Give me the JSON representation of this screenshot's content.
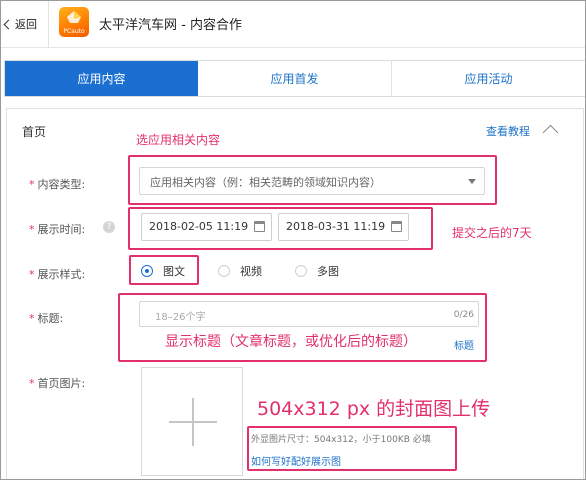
{
  "header": {
    "back_label": "返回",
    "logo_text": "PCauto",
    "title": "太平洋汽车网 - 内容合作"
  },
  "tabs": [
    {
      "label": "应用内容",
      "active": true
    },
    {
      "label": "应用首发",
      "active": false
    },
    {
      "label": "应用活动",
      "active": false
    }
  ],
  "section": {
    "title": "首页",
    "tutorial_link": "查看教程"
  },
  "form": {
    "content_type": {
      "label": "内容类型:",
      "value": "应用相关内容（例：相关范畴的领域知识内容）"
    },
    "display_time": {
      "label": "展示时间:",
      "help": "?",
      "start": "2018-02-05 11:19",
      "end": "2018-03-31 11:19"
    },
    "display_style": {
      "label": "展示样式:",
      "options": [
        "图文",
        "视频",
        "多图"
      ],
      "selected": "图文"
    },
    "title_field": {
      "label": "标题:",
      "placeholder": "18–26个字",
      "counter": "0/26",
      "tip_link_tail": "标题"
    },
    "cover_image": {
      "label": "首页图片:",
      "hint": "外显图片尺寸：504x312，小于100KB 必填",
      "help_link": "如何写好配好展示图"
    }
  },
  "annotations": {
    "select_related": "选应用相关内容",
    "seven_days": "提交之后的7天",
    "title_note": "显示标题（文章标题，或优化后的标题）",
    "cover_note": "504x312 px 的封面图上传"
  },
  "colors": {
    "accent": "#1b6fd1",
    "annotation": "#e2306c"
  }
}
